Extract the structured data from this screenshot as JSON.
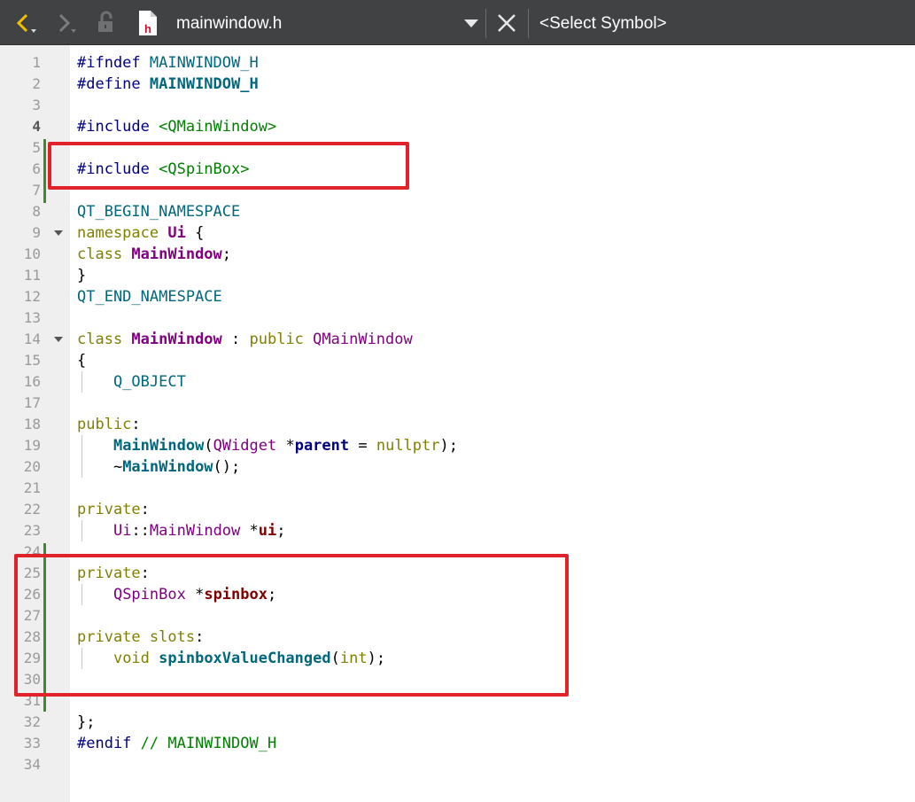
{
  "toolbar": {
    "filename": "mainwindow.h",
    "file_badge": "h",
    "symbol_selector": "<Select Symbol>",
    "accent_color": "#f0c000"
  },
  "editor": {
    "lines": [
      {
        "n": "1",
        "tokens": [
          [
            "#ifndef ",
            "t-pre"
          ],
          [
            "MAINWINDOW_H",
            "t-mac"
          ]
        ]
      },
      {
        "n": "2",
        "tokens": [
          [
            "#define ",
            "t-pre"
          ],
          [
            "MAINWINDOW_H",
            "t-macb"
          ]
        ]
      },
      {
        "n": "3",
        "tokens": []
      },
      {
        "n": "4",
        "bold": true,
        "tokens": [
          [
            "#include ",
            "t-pre"
          ],
          [
            "<QMainWindow>",
            "t-str"
          ]
        ]
      },
      {
        "n": "5",
        "tokens": []
      },
      {
        "n": "6",
        "tokens": [
          [
            "#include ",
            "t-pre"
          ],
          [
            "<QSpinBox>",
            "t-str"
          ]
        ]
      },
      {
        "n": "7",
        "tokens": []
      },
      {
        "n": "8",
        "tokens": [
          [
            "QT_BEGIN_NAMESPACE",
            "t-mac"
          ]
        ]
      },
      {
        "n": "9",
        "fold": true,
        "tokens": [
          [
            "namespace ",
            "t-kw"
          ],
          [
            "Ui",
            "t-typeb"
          ],
          [
            " {",
            "t-plain"
          ]
        ]
      },
      {
        "n": "10",
        "tokens": [
          [
            "class ",
            "t-kw"
          ],
          [
            "MainWindow",
            "t-typeb"
          ],
          [
            ";",
            "t-plain"
          ]
        ]
      },
      {
        "n": "11",
        "tokens": [
          [
            "}",
            "t-plain"
          ]
        ]
      },
      {
        "n": "12",
        "tokens": [
          [
            "QT_END_NAMESPACE",
            "t-mac"
          ]
        ]
      },
      {
        "n": "13",
        "tokens": []
      },
      {
        "n": "14",
        "fold": true,
        "tokens": [
          [
            "class ",
            "t-kw"
          ],
          [
            "MainWindow",
            "t-typeb"
          ],
          [
            " : ",
            "t-plain"
          ],
          [
            "public ",
            "t-kw"
          ],
          [
            "QMainWindow",
            "t-type"
          ]
        ]
      },
      {
        "n": "15",
        "tokens": [
          [
            "{",
            "t-plain"
          ]
        ]
      },
      {
        "n": "16",
        "guide": true,
        "tokens": [
          [
            "    Q_OBJECT",
            "t-qt"
          ]
        ]
      },
      {
        "n": "17",
        "tokens": []
      },
      {
        "n": "18",
        "tokens": [
          [
            "public",
            "t-kw"
          ],
          [
            ":",
            "t-plain"
          ]
        ]
      },
      {
        "n": "19",
        "guide": true,
        "tokens": [
          [
            "    ",
            "t-plain"
          ],
          [
            "MainWindow",
            "t-fn"
          ],
          [
            "(",
            "t-plain"
          ],
          [
            "QWidget",
            "t-type"
          ],
          [
            " *",
            "t-plain"
          ],
          [
            "parent",
            "t-param"
          ],
          [
            " = ",
            "t-plain"
          ],
          [
            "nullptr",
            "t-kw"
          ],
          [
            ");",
            "t-plain"
          ]
        ]
      },
      {
        "n": "20",
        "guide": true,
        "tokens": [
          [
            "    ~",
            "t-plain"
          ],
          [
            "MainWindow",
            "t-fn"
          ],
          [
            "();",
            "t-plain"
          ]
        ]
      },
      {
        "n": "21",
        "tokens": []
      },
      {
        "n": "22",
        "tokens": [
          [
            "private",
            "t-kw"
          ],
          [
            ":",
            "t-plain"
          ]
        ]
      },
      {
        "n": "23",
        "guide": true,
        "tokens": [
          [
            "    ",
            "t-plain"
          ],
          [
            "Ui",
            "t-type"
          ],
          [
            "::",
            "t-plain"
          ],
          [
            "MainWindow",
            "t-type"
          ],
          [
            " *",
            "t-plain"
          ],
          [
            "ui",
            "t-var"
          ],
          [
            ";",
            "t-plain"
          ]
        ]
      },
      {
        "n": "24",
        "tokens": []
      },
      {
        "n": "25",
        "tokens": [
          [
            "private",
            "t-kw"
          ],
          [
            ":",
            "t-plain"
          ]
        ]
      },
      {
        "n": "26",
        "guide": true,
        "tokens": [
          [
            "    ",
            "t-plain"
          ],
          [
            "QSpinBox",
            "t-type"
          ],
          [
            " *",
            "t-plain"
          ],
          [
            "spinbox",
            "t-var"
          ],
          [
            ";",
            "t-plain"
          ]
        ]
      },
      {
        "n": "27",
        "tokens": []
      },
      {
        "n": "28",
        "tokens": [
          [
            "private slots",
            "t-kw"
          ],
          [
            ":",
            "t-plain"
          ]
        ]
      },
      {
        "n": "29",
        "guide": true,
        "tokens": [
          [
            "    ",
            "t-plain"
          ],
          [
            "void ",
            "t-kw"
          ],
          [
            "spinboxValueChanged",
            "t-fn"
          ],
          [
            "(",
            "t-plain"
          ],
          [
            "int",
            "t-kw"
          ],
          [
            ");",
            "t-plain"
          ]
        ]
      },
      {
        "n": "30",
        "tokens": []
      },
      {
        "n": "31",
        "tokens": []
      },
      {
        "n": "32",
        "tokens": [
          [
            "};",
            "t-plain"
          ]
        ]
      },
      {
        "n": "33",
        "tokens": [
          [
            "#endif ",
            "t-pre"
          ],
          [
            "// MAINWINDOW_H",
            "t-cmt"
          ]
        ]
      },
      {
        "n": "34",
        "tokens": []
      }
    ]
  }
}
